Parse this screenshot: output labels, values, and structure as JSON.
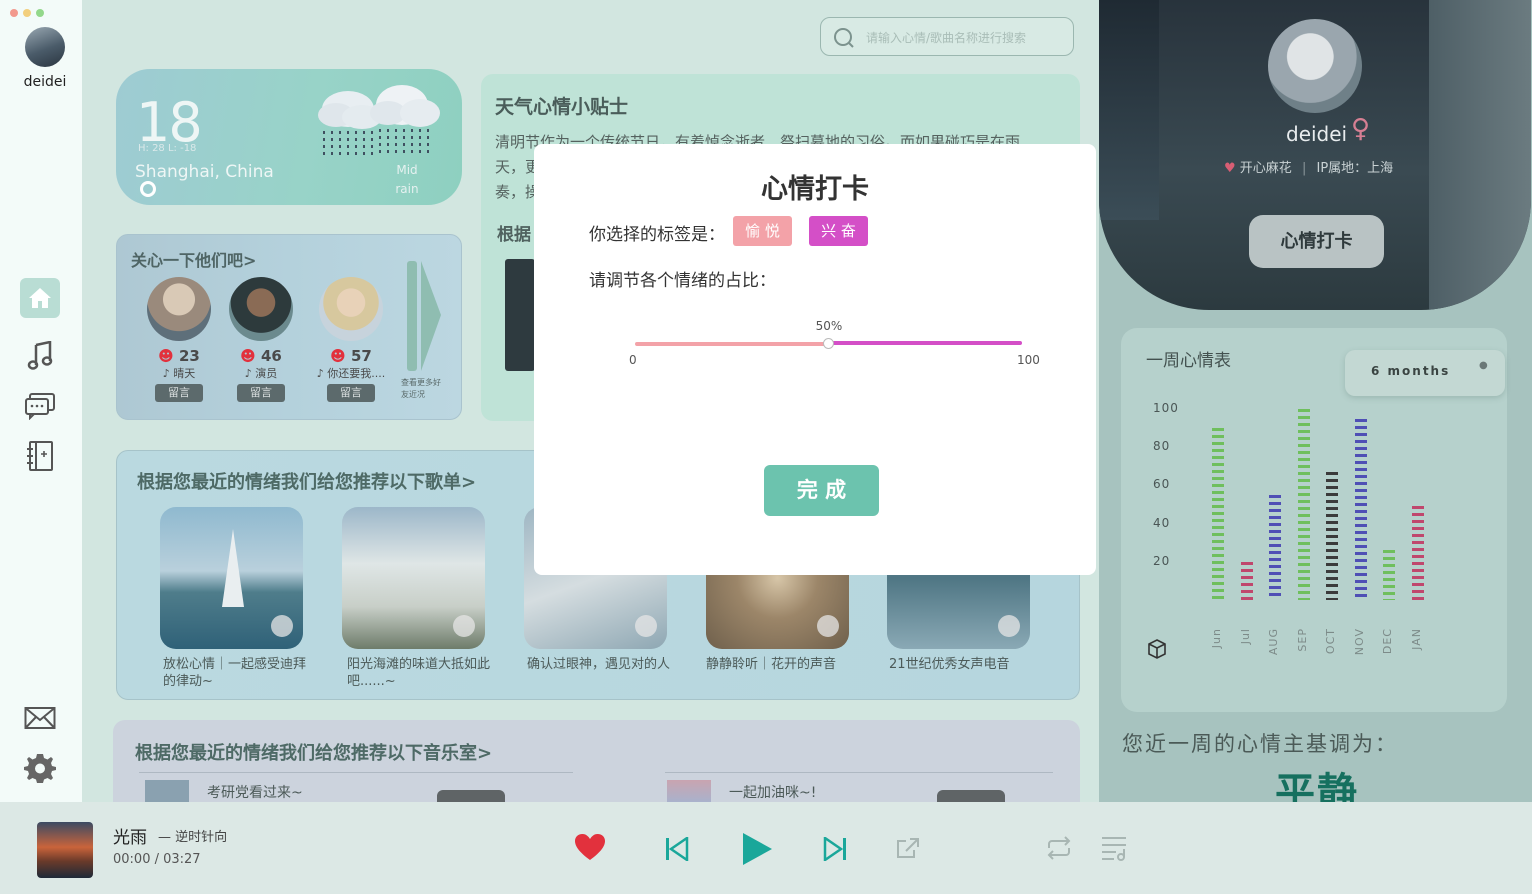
{
  "sidebar": {
    "username": "deidei",
    "nav": [
      "home-icon",
      "music-note-icon",
      "chat-icon",
      "notebook-icon"
    ],
    "bottom": [
      "mail-icon",
      "gear-icon"
    ]
  },
  "search": {
    "placeholder": "请输入心情/歌曲名称进行搜索"
  },
  "weather": {
    "temp": "18",
    "hl": "H: 28   L: -18",
    "city": "Shanghai, China",
    "desc": "Mid rain"
  },
  "tips": {
    "title": "天气心情小贴士",
    "line1": "清明节作为一个传统节日，有着悼念逝者、祭扫墓地的习俗。而如果碰巧是在雨",
    "line2": "天，更",
    "line3": "奏，操",
    "sub": "根据"
  },
  "care": {
    "title": "关心一下他们吧>",
    "friends": [
      {
        "count": "23",
        "song": "晴天",
        "btn": "留言"
      },
      {
        "count": "46",
        "song": "演员",
        "btn": "留言"
      },
      {
        "count": "57",
        "song": "你还要我....",
        "btn": "留言"
      }
    ],
    "more": "查看更多好友近况"
  },
  "songs": {
    "title": "根据您最近的情绪我们给您推荐以下歌单>",
    "items": [
      {
        "cap": "放松心情｜一起感受迪拜的律动~"
      },
      {
        "cap": "阳光海滩的味道大抵如此吧......~"
      },
      {
        "cap": "确认过眼神，遇见对的人"
      },
      {
        "cap": "静静聆听｜花开的声音"
      },
      {
        "cap": "21世纪优秀女声电音"
      }
    ]
  },
  "rooms": {
    "title": "根据您最近的情绪我们给您推荐以下音乐室>",
    "items": [
      {
        "name": "考研党看过来~"
      },
      {
        "name": "一起加油咪~!"
      }
    ]
  },
  "profile": {
    "name": "deidei",
    "gender": "♀",
    "label": "开心麻花",
    "ip": "IP属地：上海",
    "button": "心情打卡"
  },
  "week": {
    "title": "一周心情表",
    "range": "6 months",
    "yticks": [
      "100",
      "80",
      "60",
      "40",
      "20"
    ],
    "summary_label": "您近一周的心情主基调为：",
    "summary_value": "平静"
  },
  "chart_data": {
    "type": "bar",
    "title": "一周心情表",
    "categories": [
      "Jun",
      "Jul",
      "AUG",
      "SEP",
      "OCT",
      "NOV",
      "DEC",
      "JAN"
    ],
    "values": [
      90,
      20,
      55,
      100,
      67,
      95,
      26,
      49
    ],
    "colors": [
      "#6fbf5d",
      "#c0476d",
      "#4f4fb5",
      "#6fbf5d",
      "#3b3b3b",
      "#4f4fb5",
      "#6fbf5d",
      "#c0476d"
    ],
    "ylim": [
      0,
      110
    ]
  },
  "modal": {
    "title": "心情打卡",
    "tags_label": "你选择的标签是：",
    "tag1": "愉 悦",
    "tag2": "兴 奋",
    "adjust_label": "请调节各个情绪的占比：",
    "slider_value": 50,
    "slider_text": "50%",
    "min": "0",
    "max": "100",
    "done": "完 成"
  },
  "player": {
    "title": "光雨",
    "artist": "— 逆时针向",
    "time": "00:00 / 03:27"
  },
  "colors": {
    "accent": "#6cc3ae",
    "tag1": "#f3a2a8",
    "tag2": "#d44fc7",
    "heart": "#e2313d",
    "player_icon": "#1aa79a"
  }
}
